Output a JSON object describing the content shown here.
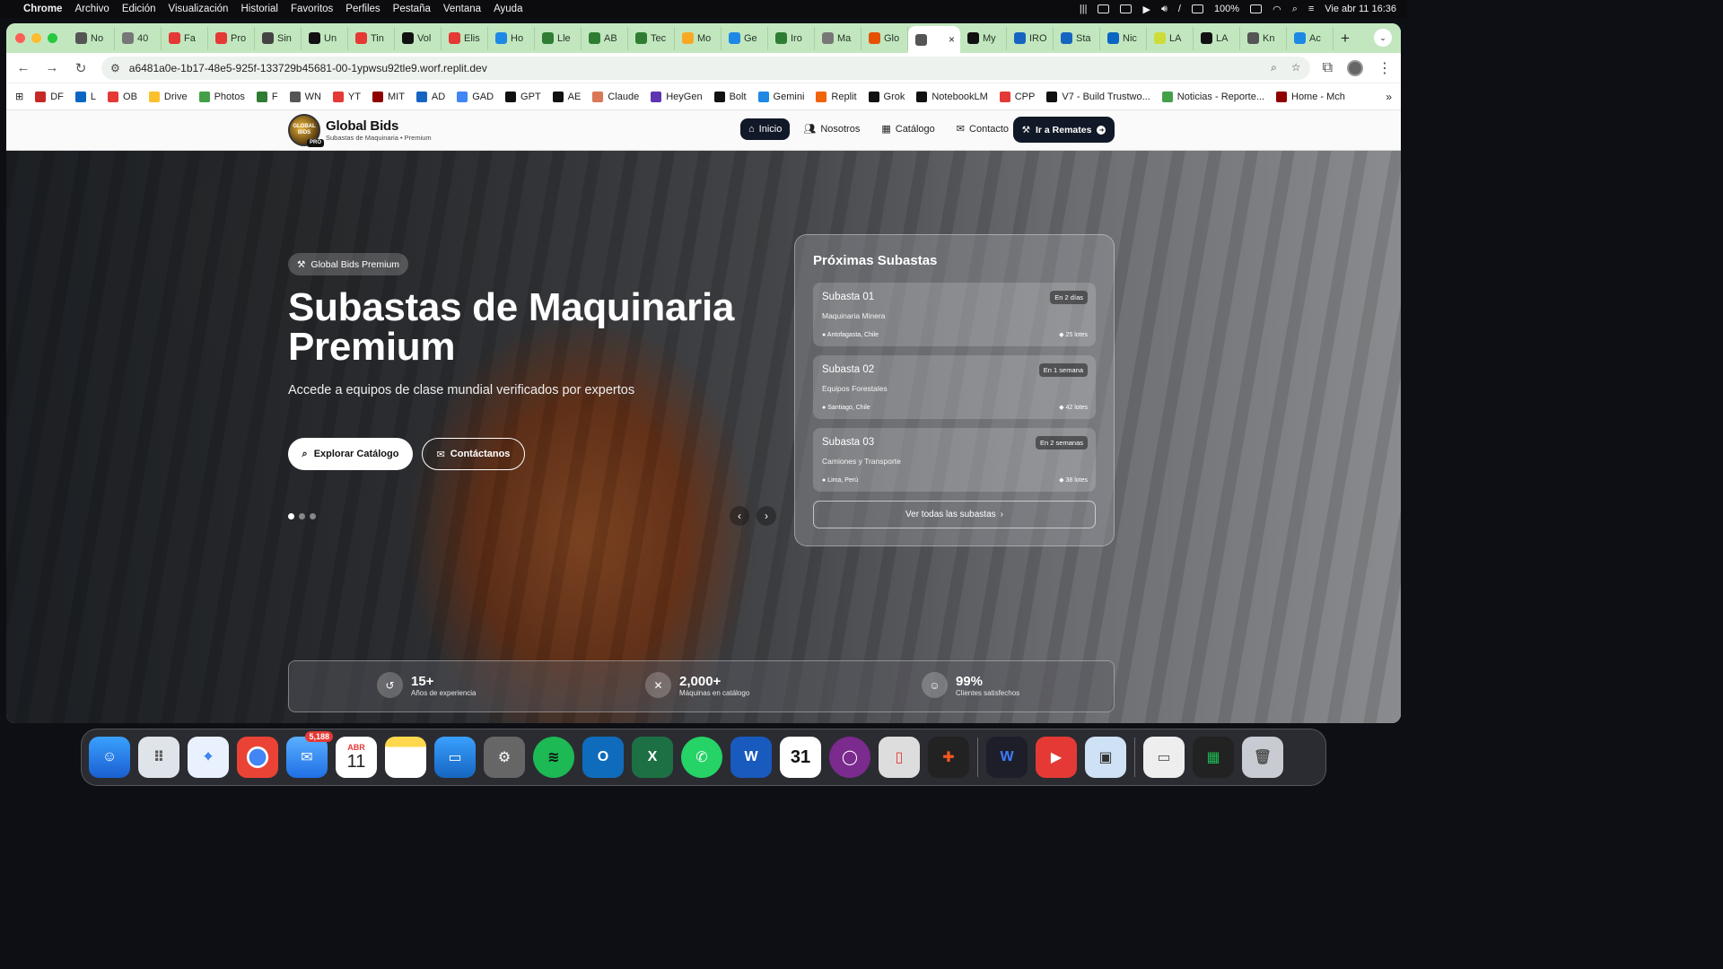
{
  "menubar": {
    "app": "Chrome",
    "items": [
      "Archivo",
      "Edición",
      "Visualización",
      "Historial",
      "Favoritos",
      "Perfiles",
      "Pestaña",
      "Ventana",
      "Ayuda"
    ],
    "battery": "100%",
    "datetime": "Vie abr 11  16:36"
  },
  "tabs": [
    {
      "label": "No",
      "color": "#555"
    },
    {
      "label": "40",
      "color": "#777"
    },
    {
      "label": "Fa",
      "color": "#e53935"
    },
    {
      "label": "Pro",
      "color": "#e53935"
    },
    {
      "label": "Sin",
      "color": "#444"
    },
    {
      "label": "Un",
      "color": "#111"
    },
    {
      "label": "Tin",
      "color": "#e53935"
    },
    {
      "label": "Vol",
      "color": "#111"
    },
    {
      "label": "Elis",
      "color": "#e53935"
    },
    {
      "label": "Ho",
      "color": "#1e88e5"
    },
    {
      "label": "Lle",
      "color": "#2e7d32"
    },
    {
      "label": "AB",
      "color": "#2e7d32"
    },
    {
      "label": "Tec",
      "color": "#2e7d32"
    },
    {
      "label": "Mo",
      "color": "#f9a825"
    },
    {
      "label": "Ge",
      "color": "#1e88e5"
    },
    {
      "label": "Iro",
      "color": "#2e7d32"
    },
    {
      "label": "Ma",
      "color": "#777"
    },
    {
      "label": "Glo",
      "color": "#e65100"
    },
    {
      "label": "",
      "color": "#555"
    },
    {
      "label": "My",
      "color": "#111"
    },
    {
      "label": "IRO",
      "color": "#1565c0"
    },
    {
      "label": "Sta",
      "color": "#1565c0"
    },
    {
      "label": "Nic",
      "color": "#0a66c2"
    },
    {
      "label": "LA",
      "color": "#cddc39"
    },
    {
      "label": "LA",
      "color": "#111"
    },
    {
      "label": "Kn",
      "color": "#555"
    },
    {
      "label": "Ac",
      "color": "#1e88e5"
    }
  ],
  "address": {
    "url": "a6481a0e-1b17-48e5-925f-133729b45681-00-1ypwsu92tle9.worf.replit.dev"
  },
  "bookmarks": [
    {
      "label": "DF",
      "color": "#c62828"
    },
    {
      "label": "L",
      "color": "#0a66c2"
    },
    {
      "label": "OB",
      "color": "#e53935"
    },
    {
      "label": "Drive",
      "color": "#fbc02d"
    },
    {
      "label": "Photos",
      "color": "#43a047"
    },
    {
      "label": "F",
      "color": "#2e7d32"
    },
    {
      "label": "WN",
      "color": "#555"
    },
    {
      "label": "YT",
      "color": "#e53935"
    },
    {
      "label": "MIT",
      "color": "#8e0000"
    },
    {
      "label": "AD",
      "color": "#1565c0"
    },
    {
      "label": "GAD",
      "color": "#4285f4"
    },
    {
      "label": "GPT",
      "color": "#111"
    },
    {
      "label": "AE",
      "color": "#111"
    },
    {
      "label": "Claude",
      "color": "#d97757"
    },
    {
      "label": "HeyGen",
      "color": "#5e35b1"
    },
    {
      "label": "Bolt",
      "color": "#111"
    },
    {
      "label": "Gemini",
      "color": "#1e88e5"
    },
    {
      "label": "Replit",
      "color": "#f26207"
    },
    {
      "label": "Grok",
      "color": "#111"
    },
    {
      "label": "NotebookLM",
      "color": "#111"
    },
    {
      "label": "CPP",
      "color": "#e53935"
    },
    {
      "label": "V7 - Build Trustwo...",
      "color": "#111"
    },
    {
      "label": "Noticias - Reporte...",
      "color": "#43a047"
    },
    {
      "label": "Home - Mch",
      "color": "#8e0000"
    }
  ],
  "site": {
    "brand_name": "Global Bids",
    "brand_sub": "Subastas de Maquinaria • Premium",
    "logo_text": "GLOBAL BIDS",
    "logo_badge": "PRO",
    "nav": [
      {
        "label": "Inicio",
        "icon": "home-icon"
      },
      {
        "label": "Nosotros",
        "icon": "users-icon"
      },
      {
        "label": "Catálogo",
        "icon": "grid-icon"
      },
      {
        "label": "Contacto",
        "icon": "mail-icon"
      }
    ],
    "cta": "Ir a Remates",
    "hero": {
      "badge": "Global Bids Premium",
      "title": "Subastas de Maquinaria Premium",
      "subtitle": "Accede a equipos de clase mundial verificados por expertos",
      "btn_primary": "Explorar Catálogo",
      "btn_secondary": "Contáctanos",
      "slide_count": 3,
      "active_slide": 1
    },
    "panel": {
      "title": "Próximas Subastas",
      "view_all": "Ver todas las subastas",
      "auctions": [
        {
          "name": "Subasta 01",
          "when": "En 2 días",
          "category": "Maquinaria Minera",
          "location": "Antofagasta, Chile",
          "lots": "25 lotes"
        },
        {
          "name": "Subasta 02",
          "when": "En 1 semana",
          "category": "Equipos Forestales",
          "location": "Santiago, Chile",
          "lots": "42 lotes"
        },
        {
          "name": "Subasta 03",
          "when": "En 2 semanas",
          "category": "Camiones y Transporte",
          "location": "Lima, Perú",
          "lots": "38 lotes"
        }
      ]
    },
    "stats": [
      {
        "value": "15+",
        "label": "Años de experiencia",
        "icon": "history-icon"
      },
      {
        "value": "2,000+",
        "label": "Máquinas en catálogo",
        "icon": "tools-icon"
      },
      {
        "value": "99%",
        "label": "Clientes satisfechos",
        "icon": "smile-icon"
      }
    ]
  },
  "dock": {
    "mail_badge": "5,188",
    "calendar_month": "ABR",
    "calendar_day": "11",
    "cal2_day": "31"
  }
}
